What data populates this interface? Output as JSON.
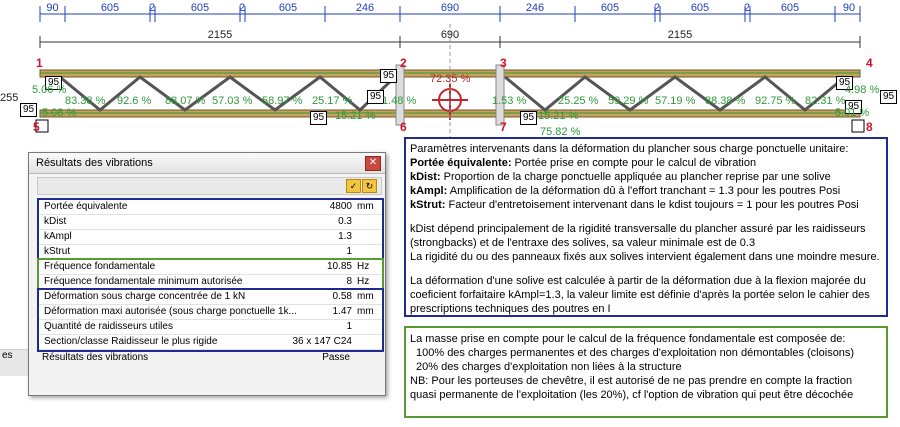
{
  "drawing": {
    "top_dims": [
      "90",
      "605",
      "2",
      "605",
      "2",
      "605",
      "246",
      "690",
      "246",
      "605",
      "2",
      "605",
      "2",
      "605",
      "90"
    ],
    "span_dims": [
      "2155",
      "690",
      "2155"
    ],
    "height_dim": "255",
    "nodes": [
      "1",
      "2",
      "3",
      "4",
      "5",
      "6",
      "7",
      "8"
    ],
    "ref_box": "95",
    "upper_pcts": [
      "5.06 %",
      "83.38 %",
      "92.6 %",
      "88.07 %",
      "57.03 %",
      "58.97 %",
      "25.17 %",
      "1.48 %",
      "1.53 %",
      "25.25 %",
      "59.29 %",
      "57.19 %",
      "88.38 %",
      "92.75 %",
      "82.31 %",
      "4.98 %"
    ],
    "lower_pcts": [
      "5.08 %",
      "15.21 %",
      "15.21 %",
      "5.01 %"
    ],
    "center_pcts": [
      "72.35 %",
      "75.82 %"
    ]
  },
  "dialog": {
    "title": "Résultats des vibrations",
    "close_symbol": "✕",
    "group1": [
      {
        "label": "Portée équivalente",
        "value": "4800",
        "unit": "mm"
      },
      {
        "label": "kDist",
        "value": "0.3",
        "unit": ""
      },
      {
        "label": "kAmpl",
        "value": "1.3",
        "unit": ""
      },
      {
        "label": "kStrut",
        "value": "1",
        "unit": ""
      }
    ],
    "group2": [
      {
        "label": "Fréquence fondamentale",
        "value": "10.85",
        "unit": "Hz"
      },
      {
        "label": "Fréquence fondamentale minimum autorisée",
        "value": "8",
        "unit": "Hz"
      }
    ],
    "group3": [
      {
        "label": "Déformation sous charge concentrée de 1 kN",
        "value": "0.58",
        "unit": "mm"
      },
      {
        "label": "Déformation maxi autorisée (sous charge ponctuelle 1k...",
        "value": "1.47",
        "unit": "mm"
      },
      {
        "label": "Quantité de raidisseurs utiles",
        "value": "1",
        "unit": ""
      },
      {
        "label": "Section/classe Raidisseur le plus rigide",
        "value": "36 x 147 C24",
        "unit": ""
      }
    ],
    "result": {
      "label": "Résultats des vibrations",
      "value": "Passe"
    }
  },
  "info1": {
    "lines": [
      {
        "bold": "",
        "text": "Paramètres intervenants dans la déformation du plancher sous charge ponctuelle unitaire:"
      },
      {
        "bold": "Portée équivalente:",
        "text": " Portée prise en compte pour le calcul de vibration"
      },
      {
        "bold": "kDist:",
        "text": " Proportion de la charge ponctuelle appliquée au plancher reprise par une solive"
      },
      {
        "bold": "kAmpl:",
        "text": " Amplification de la déformation dû à l'effort tranchant = 1.3 pour les poutres Posi"
      },
      {
        "bold": "kStrut:",
        "text": " Facteur d'entretoisement intervenant dans le kdist toujours = 1 pour les poutres Posi"
      },
      {
        "bold": "",
        "text": ""
      },
      {
        "bold": "",
        "text": "kDist dépend principalement de la rigidité transversalle du plancher assuré par les raidisseurs"
      },
      {
        "bold": "",
        "text": "(strongbacks) et de l'entraxe des solives, sa valeur minimale est de 0.3"
      },
      {
        "bold": "",
        "text": "La rigidité du ou des panneaux fixés aux solives intervient également dans une moindre mesure."
      },
      {
        "bold": "",
        "text": ""
      },
      {
        "bold": "",
        "text": "La déformation d'une solive est calculée à partir de la déformation due à la flexion majorée du"
      },
      {
        "bold": "",
        "text": "coeficient forfaitaire kAmpl=1.3, la valeur limite est définie d'après la portée selon le cahier des"
      },
      {
        "bold": "",
        "text": "prescriptions techniques des poutres en I"
      }
    ]
  },
  "info2": {
    "lines": [
      "La masse prise en compte pour le calcul de la fréquence fondamentale est composée de:",
      "  100% des charges permanentes et des charges d'exploitation non démontables (cloisons)",
      "  20% des charges d'exploitation non liées à la structure",
      "NB: Pour les porteuses de chevêtre, il est autorisé de ne pas prendre en compte la fraction",
      "quasi permanente de l'exploitation (les 20%), cf l'option de vibration qui peut être décochée"
    ]
  },
  "background": {
    "strip_label": "es"
  },
  "colors": {
    "dim_blue": "#1f3fbf",
    "pct_green": "#2e9a3a",
    "node_red": "#d4142b",
    "panel_navy": "#1e2c8f",
    "panel_green": "#5a9a35"
  }
}
